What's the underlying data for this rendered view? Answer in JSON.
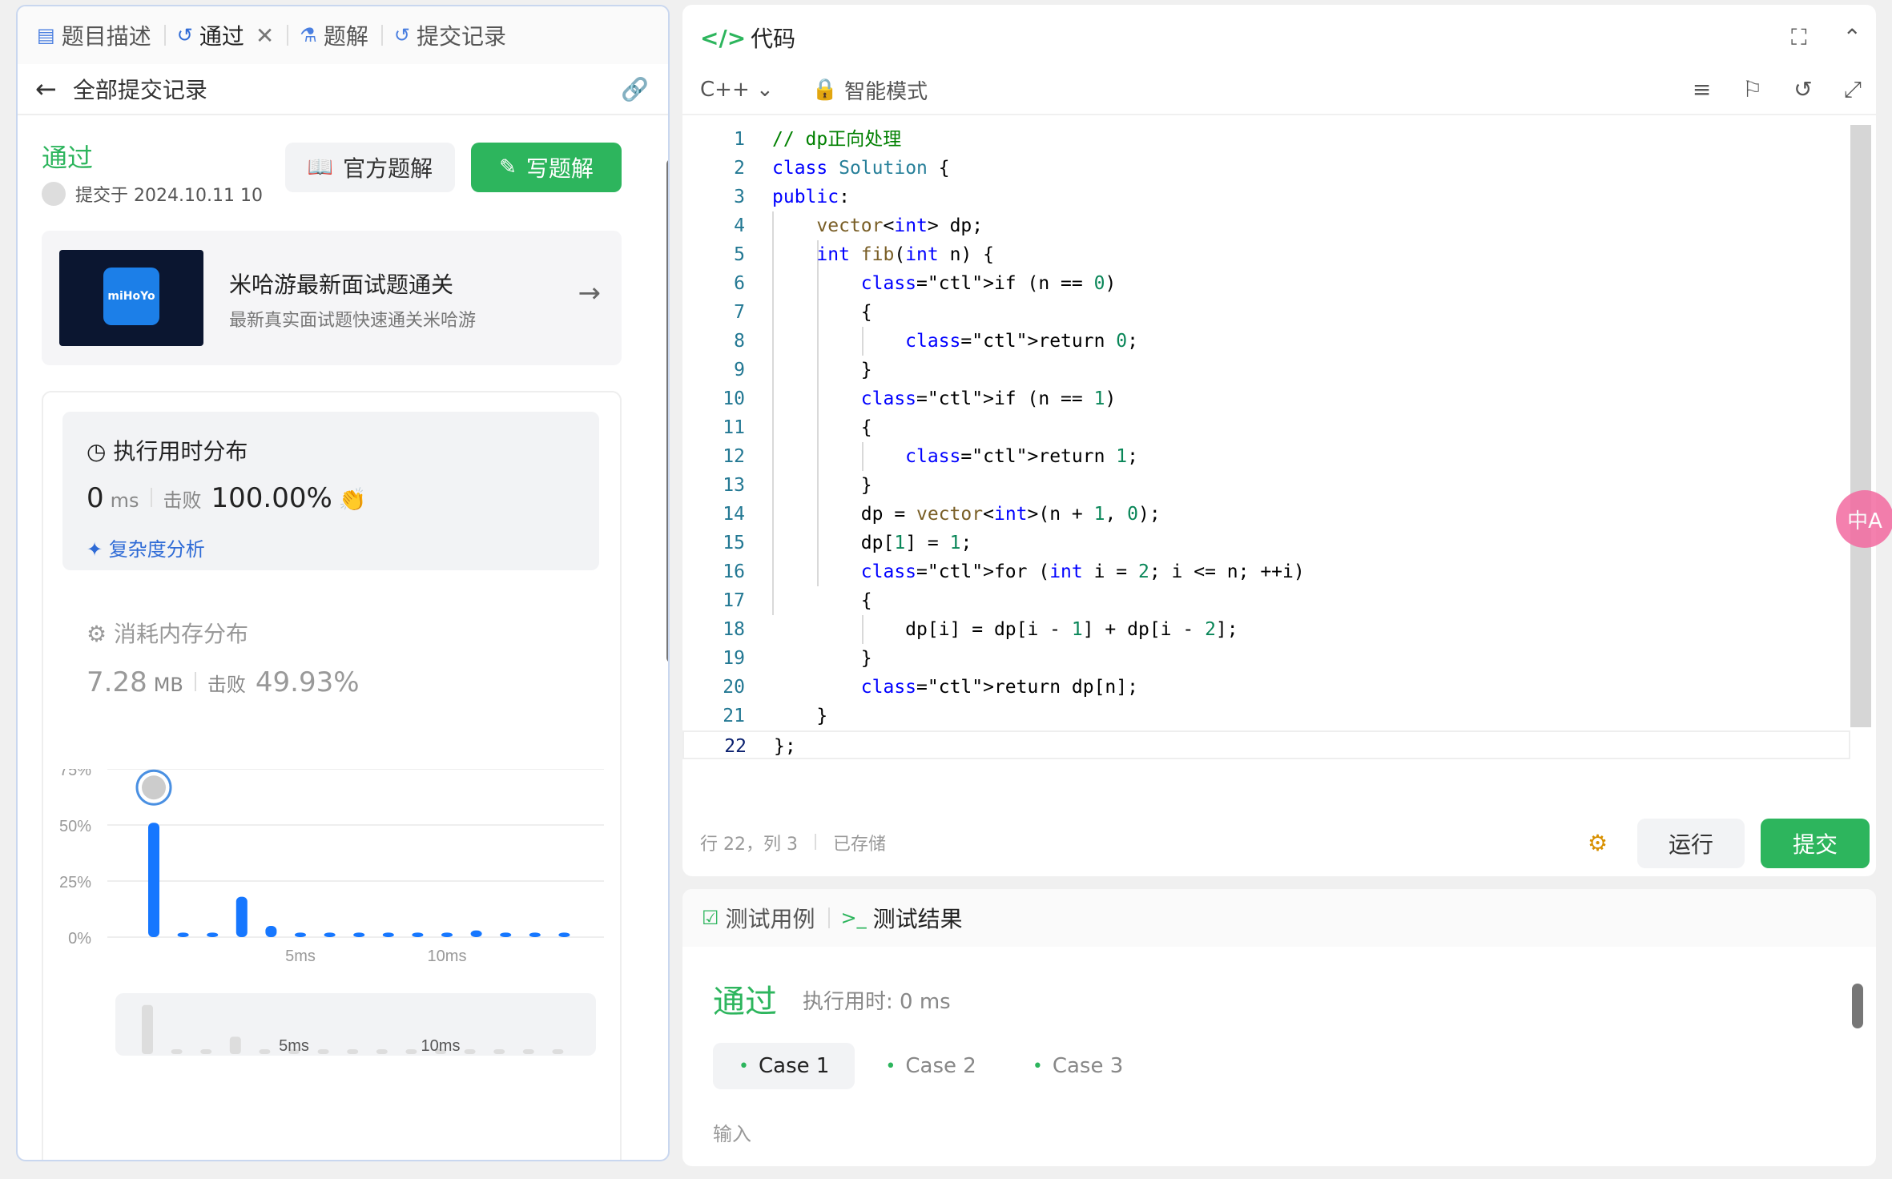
{
  "left_tabs": [
    {
      "label": "题目描述",
      "icon": "doc-icon"
    },
    {
      "label": "通过",
      "icon": "history-icon"
    },
    {
      "label": "题解",
      "icon": "flask-icon"
    },
    {
      "label": "提交记录",
      "icon": "history-icon"
    }
  ],
  "left_header": {
    "back_label": "全部提交记录"
  },
  "submission": {
    "status": "通过",
    "submitted_at": "提交于 2024.10.11 10",
    "official_btn": "官方题解",
    "write_btn": "写题解"
  },
  "ad": {
    "title": "米哈游最新面试题通关",
    "subtitle": "最新真实面试题快速通关米哈游",
    "logo_text": "miHoYo"
  },
  "runtime": {
    "title": "执行用时分布",
    "value": "0",
    "unit": "ms",
    "beat_label": "击败",
    "beat_value": "100.00%",
    "complexity_link": "复杂度分析"
  },
  "memory": {
    "title": "消耗内存分布",
    "value": "7.28",
    "unit": "MB",
    "beat_label": "击败",
    "beat_value": "49.93%"
  },
  "chart_data": {
    "type": "bar",
    "x": [
      0,
      1,
      2,
      3,
      4,
      5,
      6,
      7,
      8,
      9,
      10,
      11,
      12,
      13,
      14
    ],
    "values": [
      51,
      2,
      2,
      18,
      5,
      2,
      2,
      2,
      2,
      2,
      2,
      3,
      2,
      2,
      2
    ],
    "yticks": [
      "75%",
      "50%",
      "25%",
      "0%"
    ],
    "ylim": [
      0,
      75
    ],
    "xtick_labels": [
      "5ms",
      "10ms"
    ],
    "highlight_index": 0,
    "color": "#1677ff"
  },
  "code": {
    "title": "代码",
    "language": "C++",
    "mode": "智能模式",
    "lines": [
      "// dp正向处理",
      "class Solution {",
      "public:",
      "    vector<int> dp;",
      "    int fib(int n) {",
      "        if (n == 0)",
      "        {",
      "            return 0;",
      "        }",
      "        if (n == 1)",
      "        {",
      "            return 1;",
      "        }",
      "        dp = vector<int>(n + 1, 0);",
      "        dp[1] = 1;",
      "        for (int i = 2; i <= n; ++i)",
      "        {",
      "            dp[i] = dp[i - 1] + dp[i - 2];",
      "        }",
      "        return dp[n];",
      "    }",
      "};"
    ],
    "cursor": "行 22，列 3",
    "saved": "已存储",
    "run_btn": "运行",
    "submit_btn": "提交"
  },
  "bottom_tabs": [
    {
      "label": "测试用例",
      "icon": "checkbox-icon"
    },
    {
      "label": "测试结果",
      "icon": "terminal-icon"
    }
  ],
  "result": {
    "status": "通过",
    "time_label": "执行用时: 0 ms",
    "cases": [
      "Case 1",
      "Case 2",
      "Case 3"
    ],
    "input_label": "输入"
  },
  "translate_badge": "中A"
}
